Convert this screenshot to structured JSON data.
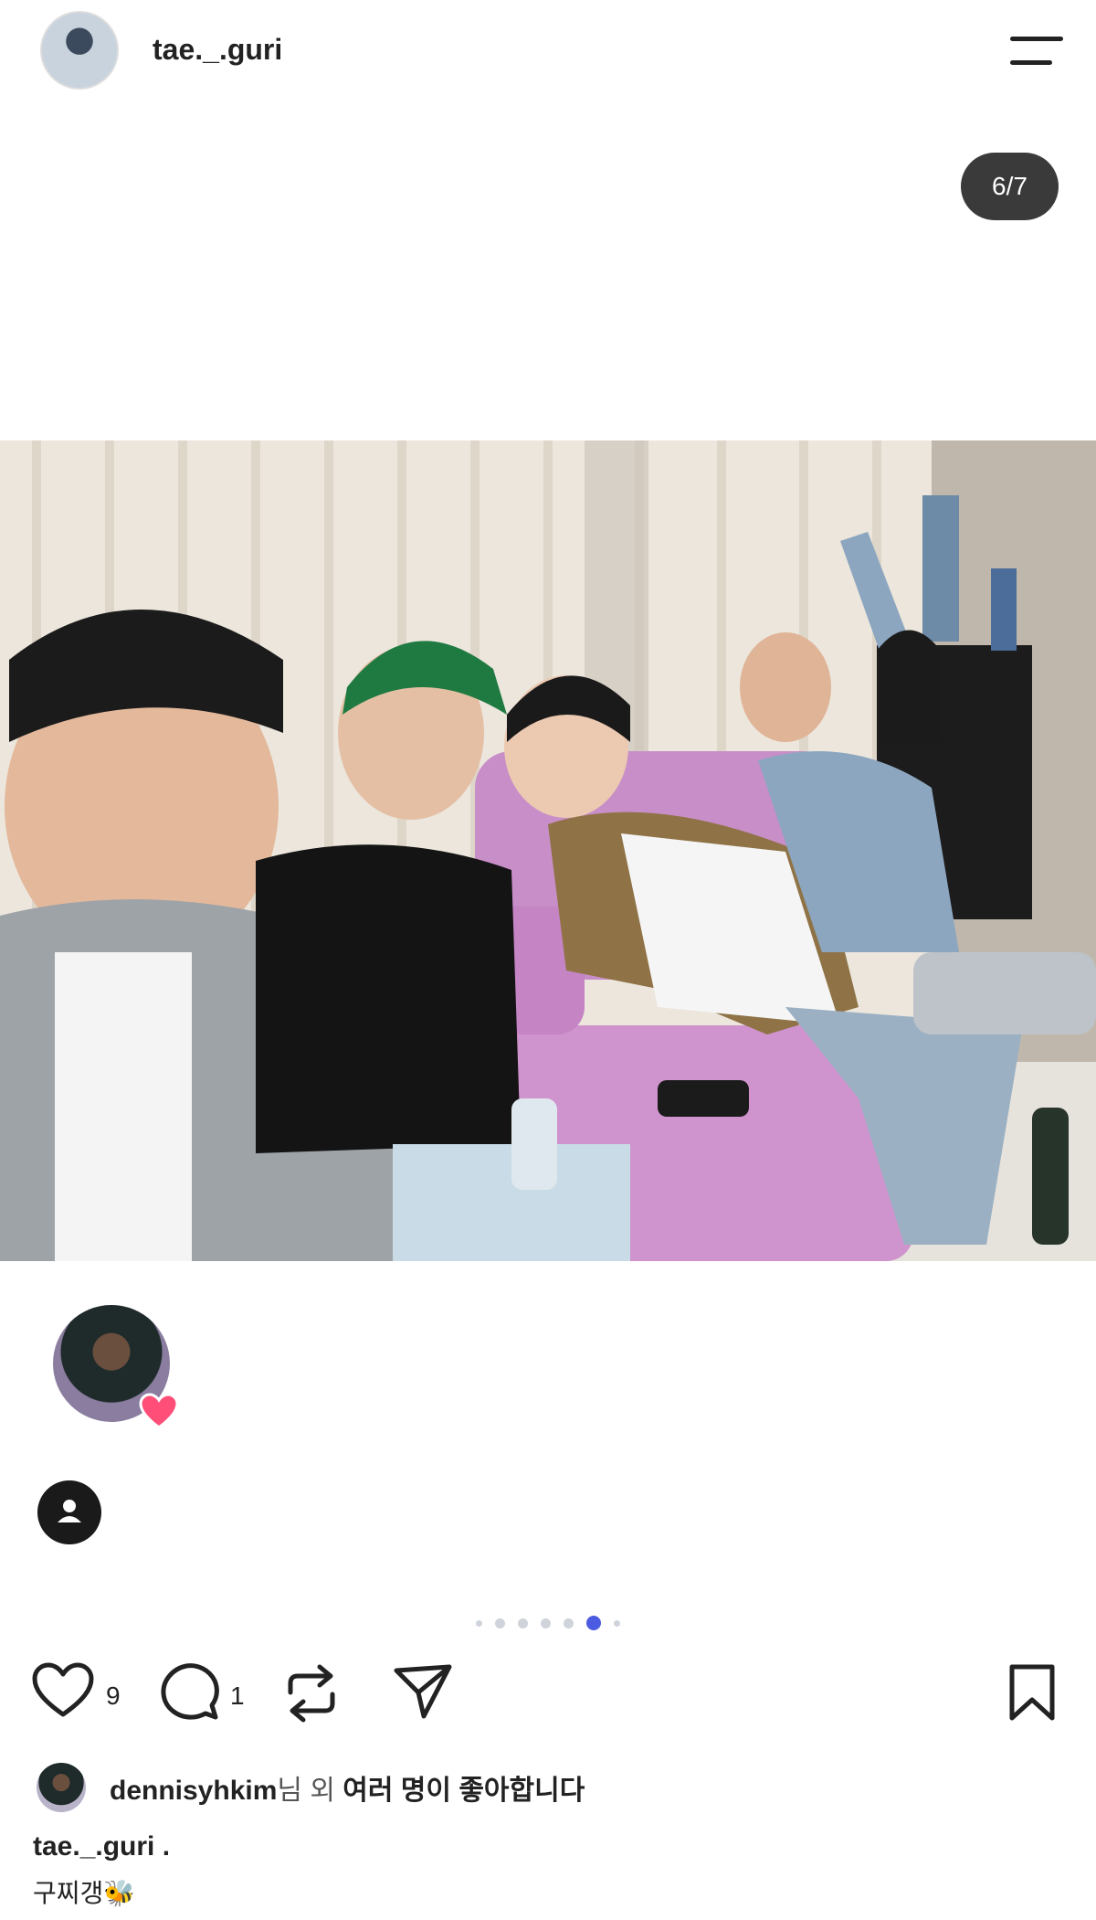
{
  "header": {
    "username": "tae._.guri"
  },
  "post": {
    "counter": "6/7"
  },
  "carousel": {
    "total": 7,
    "active_index": 5
  },
  "actions": {
    "like_count": "9",
    "comment_count": "1"
  },
  "likes": {
    "user": "dennisyhkim",
    "suffix_light": "님 외 ",
    "suffix_bold": "여러 명이 좋아합니다"
  },
  "caption": {
    "user": "tae._.guri .",
    "text": "구찌갱🐝"
  },
  "colors": {
    "accent": "#4b5ce0",
    "counter_bg": "#3a3a3a",
    "text": "#222222"
  }
}
